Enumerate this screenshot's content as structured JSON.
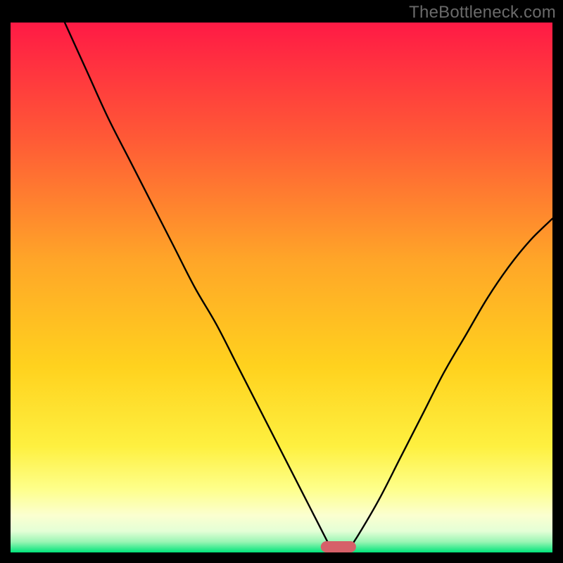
{
  "watermark": "TheBottleneck.com",
  "chart_data": {
    "type": "line",
    "title": "",
    "xlabel": "",
    "ylabel": "",
    "xlim": [
      0,
      100
    ],
    "ylim": [
      0,
      100
    ],
    "gradient_colors": {
      "top": "#ff1a45",
      "mid_upper": "#fe8a2d",
      "mid": "#ffd21e",
      "lower": "#feff63",
      "pale": "#feffbf",
      "green": "#00e47a"
    },
    "series": [
      {
        "name": "left-branch",
        "x": [
          10,
          14,
          18,
          22,
          26,
          30,
          34,
          38,
          42,
          46,
          50,
          54,
          56,
          58,
          59,
          59.5
        ],
        "y": [
          100,
          91,
          82,
          74,
          66,
          58,
          50,
          43,
          35,
          27,
          19,
          11,
          7,
          3,
          1,
          0
        ]
      },
      {
        "name": "right-branch",
        "x": [
          62,
          64,
          68,
          72,
          76,
          80,
          84,
          88,
          92,
          96,
          100
        ],
        "y": [
          0,
          3,
          10,
          18,
          26,
          34,
          41,
          48,
          54,
          59,
          63
        ]
      }
    ],
    "marker": {
      "name": "bottleneck-marker",
      "shape": "rounded-bar",
      "x_center": 60.5,
      "y": 0,
      "width_pct": 6.5,
      "color": "#d66069"
    }
  }
}
